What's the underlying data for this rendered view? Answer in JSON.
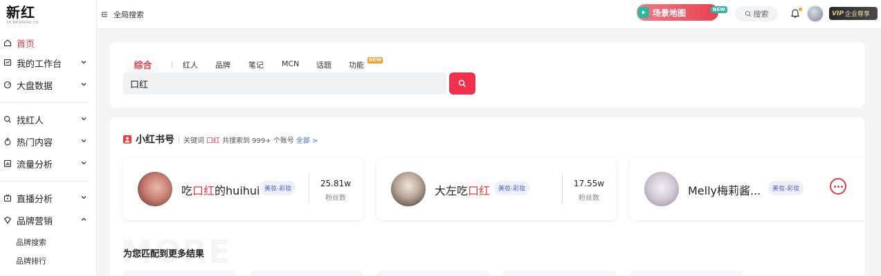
{
  "logo": {
    "title": "新红",
    "subtitle": "XH.NEWRANK.CN"
  },
  "sidebar": {
    "items": [
      {
        "label": "首页",
        "icon": "home-icon"
      },
      {
        "label": "我的工作台",
        "icon": "workbench-icon"
      },
      {
        "label": "大盘数据",
        "icon": "data-icon"
      },
      {
        "label": "找红人",
        "icon": "search-icon"
      },
      {
        "label": "热门内容",
        "icon": "fire-icon"
      },
      {
        "label": "流量分析",
        "icon": "chart-icon"
      },
      {
        "label": "直播分析",
        "icon": "live-icon"
      },
      {
        "label": "品牌营销",
        "icon": "brand-icon"
      }
    ],
    "sub_items": [
      "品牌搜索",
      "品牌排行"
    ]
  },
  "topbar": {
    "global_search": "全局搜索",
    "scene_map": "场景地图",
    "scene_new": "NEW",
    "search": "搜索",
    "vip_tag": "VIP",
    "vip_text": "企业尊享"
  },
  "search": {
    "tabs": [
      "综合",
      "红人",
      "品牌",
      "笔记",
      "MCN",
      "话题",
      "功能"
    ],
    "tab_new": "NEW",
    "query": "口红"
  },
  "results": {
    "section_title": "小红书号",
    "meta_prefix": "关键词",
    "keyword": "口红",
    "meta_suffix": "共搜索到 999+ 个账号",
    "all_link": "全部 >",
    "accounts": [
      {
        "name_pre": "吃",
        "name_hl": "口红",
        "name_post": "的huihui",
        "tag": "美妆-彩妆",
        "fans": "25.81w",
        "fans_label": "粉丝数"
      },
      {
        "name_pre": "大左吃",
        "name_hl": "口红",
        "name_post": "",
        "tag": "美妆-彩妆",
        "fans": "17.55w",
        "fans_label": "粉丝数"
      },
      {
        "name_pre": "Melly梅莉酱...",
        "name_hl": "",
        "name_post": "",
        "tag": "美妆-彩妆",
        "fans": "",
        "fans_label": ""
      }
    ],
    "more_title": "为您匹配到更多结果",
    "more_watermark": "MORE"
  },
  "colors": {
    "accent": "#e83a45",
    "search_button": "#f2304d",
    "link": "#3a6fd8",
    "new_badge": "#f4a026",
    "scene_badge": "#2bb8a0"
  }
}
